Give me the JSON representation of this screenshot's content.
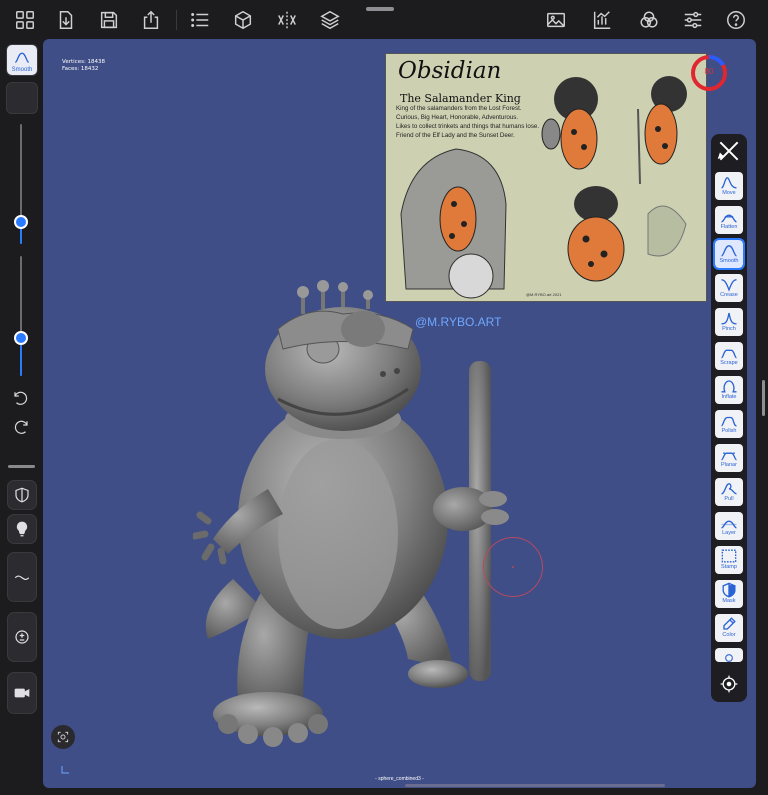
{
  "toolbar": {
    "left_icons": [
      "grid-icon",
      "import-icon",
      "save-icon",
      "share-icon",
      "list-icon",
      "cube-icon",
      "symmetry-icon",
      "layers-icon"
    ],
    "right_icons": [
      "image-icon",
      "chart-icon",
      "materials-icon",
      "sliders-icon",
      "help-icon"
    ]
  },
  "left_panel": {
    "active_tool_label": "Smooth",
    "size_slider_value": 0.18,
    "intensity_slider_value": 0.33
  },
  "viewport": {
    "vertices_label": "Vertices: 18438",
    "faces_label": "Faces:    18432",
    "watermark": "@M.RYBO.ART",
    "scene_name": "- sphere_combined3 -",
    "accent_color": "#3f4e86"
  },
  "reference": {
    "title": "Obsidian",
    "subtitle": "The Salamander King",
    "description": [
      "King of the salamanders from the Lost Forest.",
      "Curious, Big Heart, Honorable, Adventurous.",
      "Likes to collect trinkets and things that humans lose.",
      "Friend of the Elf Lady and the Sunset Deer."
    ],
    "credit": "@M.RYBO.art 2021"
  },
  "gauge": {
    "value": "80"
  },
  "tools": [
    {
      "label": "Move",
      "icon": "move-icon"
    },
    {
      "label": "Flatten",
      "icon": "flatten-icon"
    },
    {
      "label": "Smooth",
      "icon": "smooth-icon"
    },
    {
      "label": "Crease",
      "icon": "crease-icon"
    },
    {
      "label": "Pinch",
      "icon": "pinch-icon"
    },
    {
      "label": "Scrape",
      "icon": "scrape-icon"
    },
    {
      "label": "Inflate",
      "icon": "inflate-icon"
    },
    {
      "label": "Polish",
      "icon": "polish-icon"
    },
    {
      "label": "Planar",
      "icon": "planar-icon"
    },
    {
      "label": "Pull",
      "icon": "pull-icon"
    },
    {
      "label": "Layer",
      "icon": "layer-icon"
    },
    {
      "label": "Stamp",
      "icon": "stamp-icon"
    },
    {
      "label": "Mask",
      "icon": "mask-icon"
    },
    {
      "label": "Color",
      "icon": "color-icon"
    }
  ],
  "active_tool": "Smooth"
}
